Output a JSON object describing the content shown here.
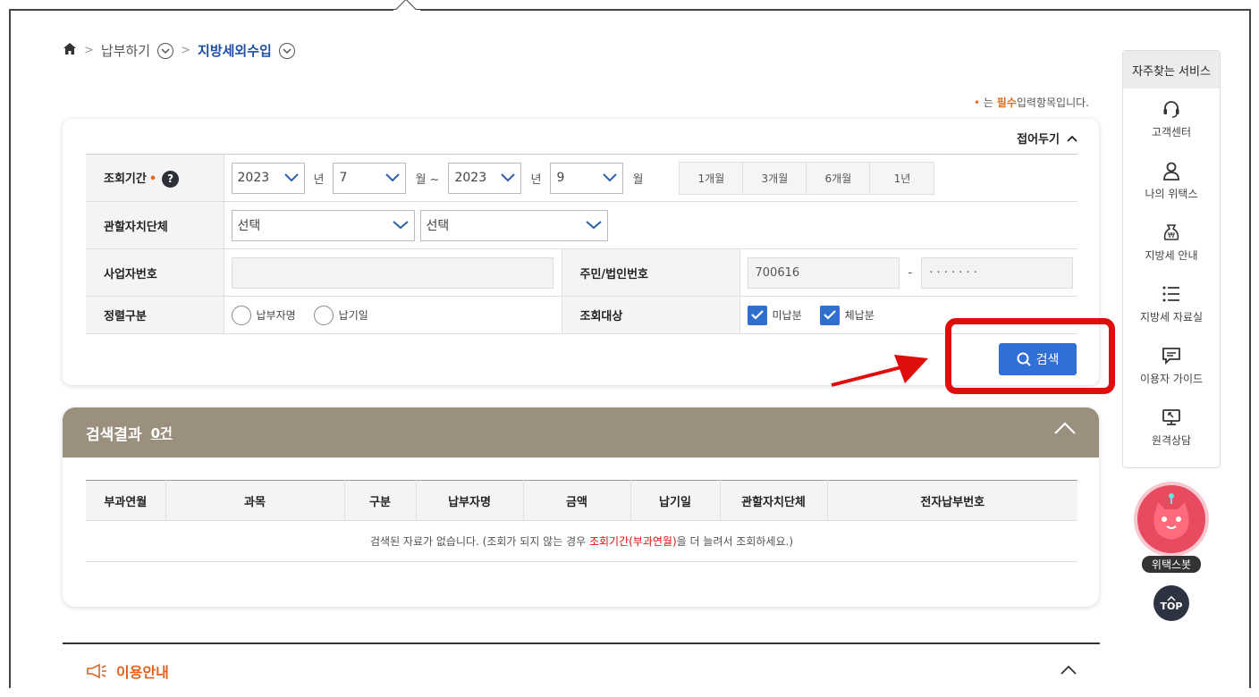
{
  "breadcrumb": {
    "level1": "납부하기",
    "level2": "지방세외수입"
  },
  "required_note": {
    "prefix": "는",
    "em": "필수",
    "suffix": "입력항목입니다."
  },
  "panel": {
    "fold_label": "접어두기"
  },
  "form": {
    "period": {
      "label": "조회기간",
      "from_year": "2023",
      "year_unit": "년",
      "from_month": "7",
      "month_unit_range": "월 ~",
      "to_year": "2023",
      "to_month": "9",
      "month_unit": "월",
      "quick_buttons": [
        "1개월",
        "3개월",
        "6개월",
        "1년"
      ]
    },
    "authority": {
      "label": "관할자치단체",
      "select1": "선택",
      "select2": "선택"
    },
    "business_no": {
      "label": "사업자번호",
      "value": ""
    },
    "resident_no": {
      "label": "주민/법인번호",
      "front": "700616",
      "dash": "-",
      "back": "· · · · · · ·"
    },
    "sort": {
      "label": "정렬구분",
      "options": [
        "납부자명",
        "납기일"
      ]
    },
    "target": {
      "label": "조회대상",
      "options": [
        "미납분",
        "체납분"
      ]
    },
    "search_label": "검색"
  },
  "results": {
    "title": "검색결과",
    "count": "0건",
    "columns": [
      "부과연월",
      "과목",
      "구분",
      "납부자명",
      "금액",
      "납기일",
      "관할자치단체",
      "전자납부번호"
    ],
    "empty_prefix": "검색된 자료가 없습니다. (조회가 되지 않는 경우 ",
    "empty_em": "조회기간(부과연월)",
    "empty_suffix": "을 더 늘려서 조회하세요.)"
  },
  "guide": {
    "label": "이용안내"
  },
  "quick_menu": {
    "title": "자주찾는 서비스",
    "items": [
      "고객센터",
      "나의 위택스",
      "지방세 안내",
      "지방세 자료실",
      "이용자 가이드",
      "원격상담"
    ]
  },
  "bot_label": "위택스봇",
  "top_label": "TOP",
  "colors": {
    "primary": "#2f6fd6",
    "header_brown": "#9b8f7d",
    "required": "#e46c1c",
    "highlight_box": "#e00d0d"
  }
}
